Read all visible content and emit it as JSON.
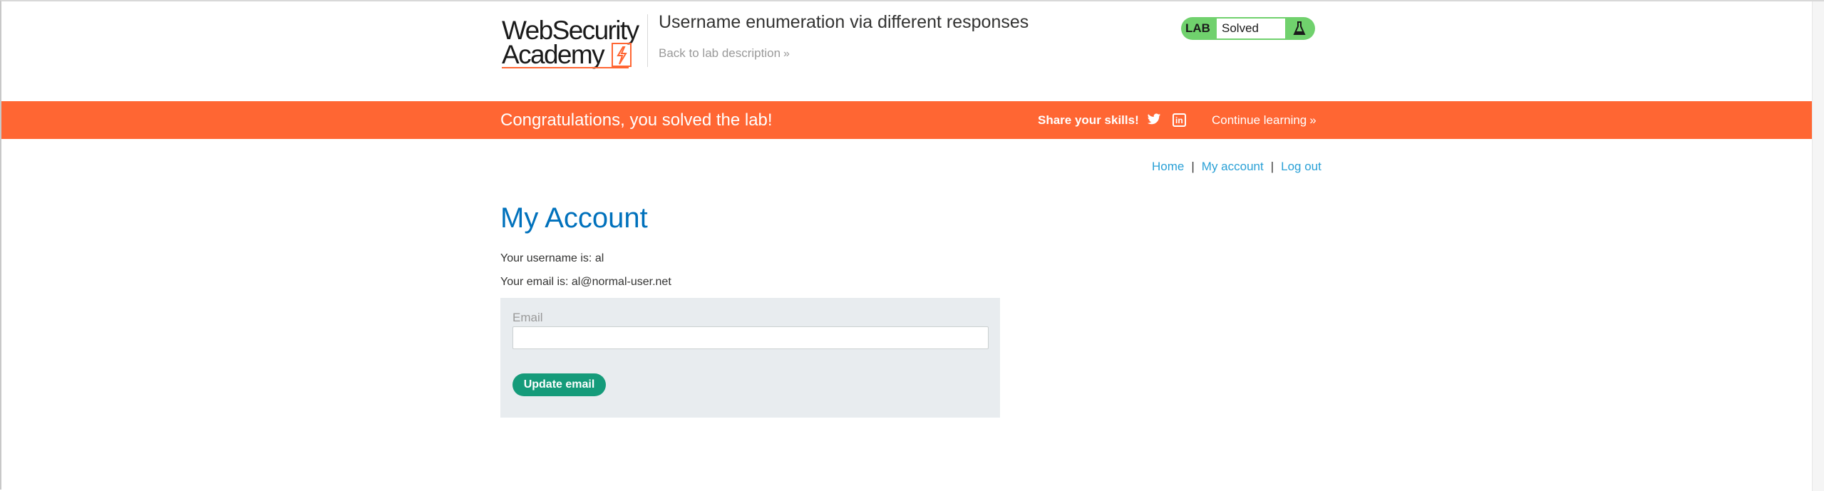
{
  "header": {
    "logo_line1": "WebSecurity",
    "logo_line2": "Academy",
    "lab_title": "Username enumeration via different responses",
    "back_link": "Back to lab description",
    "back_chevron": "»",
    "status_tag": "LAB",
    "status_value": "Solved",
    "status_icon": "flask-icon"
  },
  "banner": {
    "message": "Congratulations, you solved the lab!",
    "share_label": "Share your skills!",
    "twitter_icon": "twitter-icon",
    "linkedin_icon": "linkedin-icon",
    "continue_label": "Continue learning",
    "continue_chevron": "»"
  },
  "nav": {
    "home": "Home",
    "my_account": "My account",
    "logout": "Log out",
    "separator": "|"
  },
  "account": {
    "title": "My Account",
    "username_line": "Your username is: al",
    "email_line": "Your email is: al@normal-user.net"
  },
  "form": {
    "email_label": "Email",
    "email_value": "",
    "submit_label": "Update email"
  },
  "colors": {
    "accent_orange": "#ff6633",
    "status_green": "#70d16d",
    "title_blue": "#0071bc",
    "link_blue": "#29a0d6",
    "button_green": "#159b7a"
  }
}
